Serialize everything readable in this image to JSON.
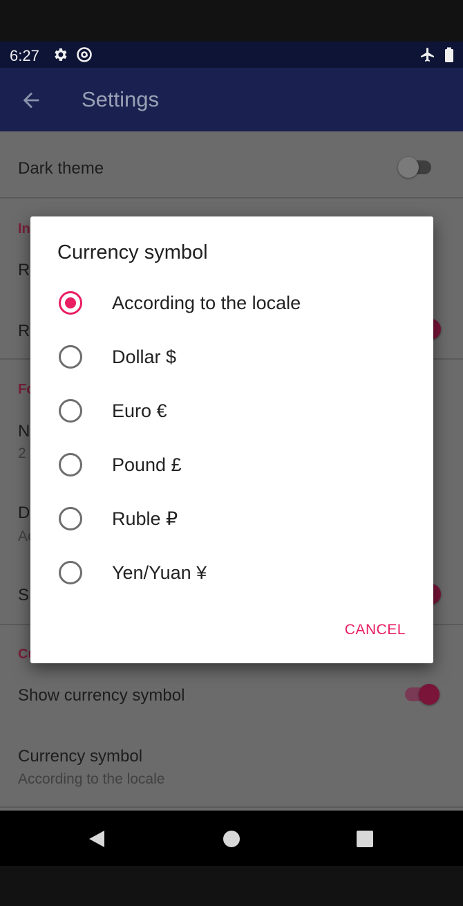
{
  "status_bar": {
    "time": "6:27",
    "icons": [
      "gear-icon",
      "at-sign-icon",
      "airplane-icon",
      "battery-icon"
    ]
  },
  "app_bar": {
    "title": "Settings",
    "back_icon": "arrow-back-icon"
  },
  "background": {
    "dark_theme_label": "Dark theme",
    "cat_interface": "In",
    "row_r1": "R",
    "row_r2": "R",
    "cat_format": "Fo",
    "row_n": "N",
    "row_n_sub": "2",
    "row_d": "D",
    "row_d_sub": "Ac",
    "row_s": "S",
    "cat_currency": "Cu",
    "show_currency_label": "Show currency symbol",
    "currency_symbol_label": "Currency symbol",
    "currency_symbol_value": "According to the locale"
  },
  "dialog": {
    "title": "Currency symbol",
    "selected_index": 0,
    "options": [
      "According to the locale",
      "Dollar $",
      "Euro €",
      "Pound £",
      "Ruble ₽",
      "Yen/Yuan ¥"
    ],
    "cancel_label": "CANCEL"
  },
  "colors": {
    "accent": "#e91e63",
    "app_bar": "#1a2150",
    "status_bar": "#0e1435",
    "scrim_content": "#6b6b6b"
  },
  "nav_bar": {
    "icons": [
      "back-triangle-icon",
      "home-circle-icon",
      "recents-square-icon"
    ]
  }
}
